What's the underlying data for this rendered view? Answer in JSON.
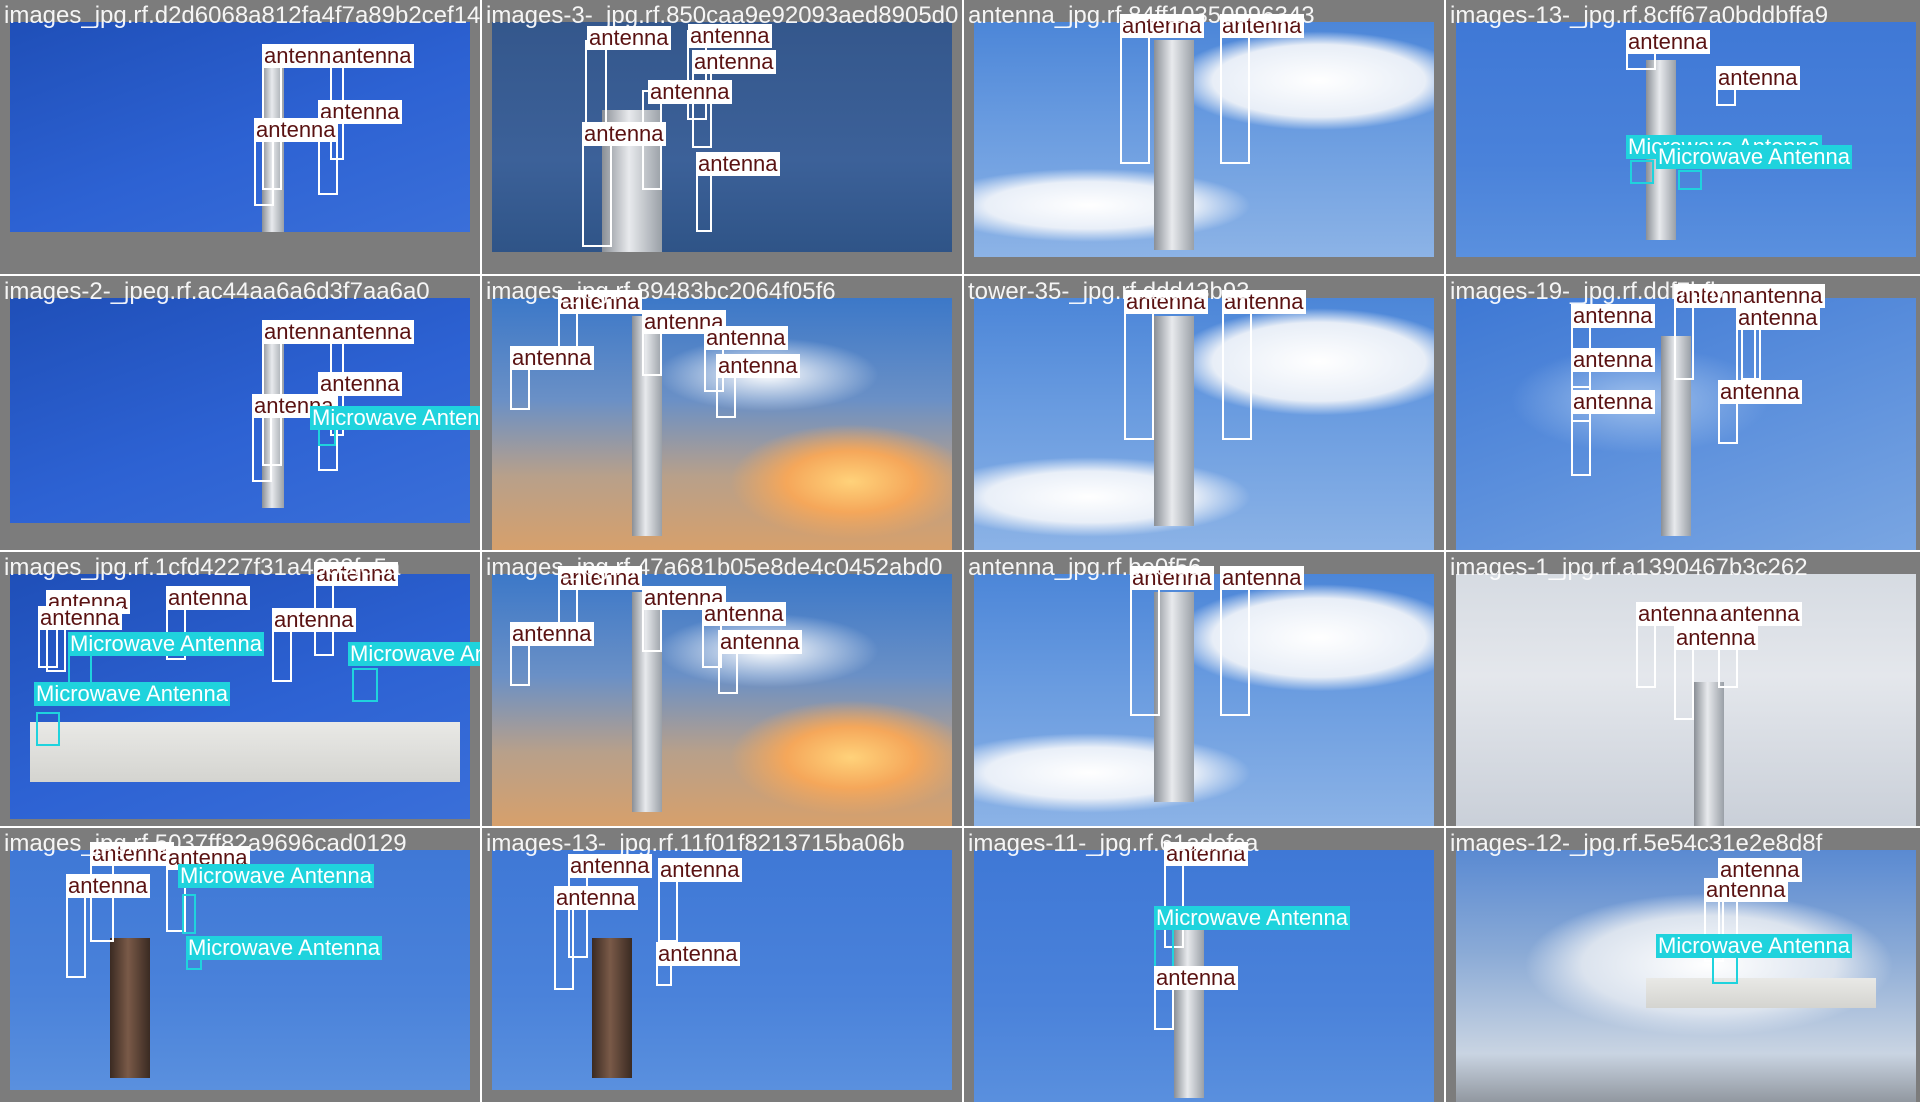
{
  "colors": {
    "antenna_label_bg": "#ffffff",
    "antenna_label_text": "#5a1212",
    "antenna_box": "#ffffff",
    "microwave_label_bg": "#1fd3dd",
    "microwave_label_text": "#ffffff",
    "microwave_box": "#1fd3dd",
    "cell_bg": "#7c7c7c"
  },
  "tiles": [
    {
      "filename": "images_jpg.rf.d2d6068a812fa4f7a89b2cef14",
      "sky": "sky-deep",
      "labels": [
        {
          "cls": "antenna",
          "text": "antenna"
        },
        {
          "cls": "antenna",
          "text": "antenna"
        },
        {
          "cls": "antenna",
          "text": "antenna"
        },
        {
          "cls": "antenna",
          "text": "antenna"
        }
      ]
    },
    {
      "filename": "images-3-_jpg.rf.850caa9e92093aed8905d0",
      "sky": "sky-navy",
      "labels": [
        {
          "cls": "antenna",
          "text": "antenna"
        },
        {
          "cls": "antenna",
          "text": "antenna"
        },
        {
          "cls": "antenna",
          "text": "antenna"
        },
        {
          "cls": "antenna",
          "text": "antenna"
        },
        {
          "cls": "antenna",
          "text": "antenna"
        },
        {
          "cls": "antenna",
          "text": "antenna"
        }
      ]
    },
    {
      "filename": "antenna_jpg.rf.84ff10350996343",
      "sky": "sky-cloud",
      "labels": [
        {
          "cls": "antenna",
          "text": "antenna"
        },
        {
          "cls": "antenna",
          "text": "antenna"
        }
      ]
    },
    {
      "filename": "images-13-_jpg.rf.8cff67a0bddbffa9",
      "sky": "sky-blue",
      "labels": [
        {
          "cls": "antenna",
          "text": "antenna"
        },
        {
          "cls": "antenna",
          "text": "antenna"
        },
        {
          "cls": "microwave",
          "text": "Microwave Antenna"
        },
        {
          "cls": "microwave",
          "text": "Microwave Antenna"
        }
      ]
    },
    {
      "filename": "images-2-_jpeg.rf.ac44aa6a6d3f7aa6a0",
      "sky": "sky-deep",
      "labels": [
        {
          "cls": "antenna",
          "text": "antenna"
        },
        {
          "cls": "antenna",
          "text": "antenna"
        },
        {
          "cls": "antenna",
          "text": "antenna"
        },
        {
          "cls": "antenna",
          "text": "antenna"
        },
        {
          "cls": "microwave",
          "text": "Microwave Antenna"
        }
      ]
    },
    {
      "filename": "images_jpg.rf.89483bc2064f05f6",
      "sky": "sky-sunset",
      "labels": [
        {
          "cls": "antenna",
          "text": "antenna"
        },
        {
          "cls": "antenna",
          "text": "antenna"
        },
        {
          "cls": "antenna",
          "text": "antenna"
        },
        {
          "cls": "antenna",
          "text": "antenna"
        },
        {
          "cls": "antenna",
          "text": "antenna"
        }
      ]
    },
    {
      "filename": "tower-35-_jpg.rf.ddd43b93",
      "sky": "sky-cloud",
      "labels": [
        {
          "cls": "antenna",
          "text": "antenna"
        },
        {
          "cls": "antenna",
          "text": "antenna"
        }
      ]
    },
    {
      "filename": "images-19-_jpg.rf.ddf7bfb",
      "sky": "sky-lightblue",
      "labels": [
        {
          "cls": "antenna",
          "text": "antenna"
        },
        {
          "cls": "antenna",
          "text": "antenna"
        },
        {
          "cls": "antenna",
          "text": "antenna"
        },
        {
          "cls": "antenna",
          "text": "antenna"
        },
        {
          "cls": "antenna",
          "text": "antenna"
        },
        {
          "cls": "antenna",
          "text": "antenna"
        },
        {
          "cls": "antenna",
          "text": "antenna"
        }
      ]
    },
    {
      "filename": "images_jpg.rf.1cfd4227f31a4983fe5a",
      "sky": "sky-deep",
      "labels": [
        {
          "cls": "antenna",
          "text": "antenna"
        },
        {
          "cls": "antenna",
          "text": "antenna"
        },
        {
          "cls": "antenna",
          "text": "antenna"
        },
        {
          "cls": "antenna",
          "text": "antenna"
        },
        {
          "cls": "antenna",
          "text": "antenna"
        },
        {
          "cls": "microwave",
          "text": "Microwave Antenna"
        },
        {
          "cls": "microwave",
          "text": "Microwave Antenna"
        },
        {
          "cls": "microwave",
          "text": "Microwave Antenna"
        }
      ]
    },
    {
      "filename": "images_jpg.rf.47a681b05e8de4c0452abd0",
      "sky": "sky-sunset",
      "labels": [
        {
          "cls": "antenna",
          "text": "antenna"
        },
        {
          "cls": "antenna",
          "text": "antenna"
        },
        {
          "cls": "antenna",
          "text": "antenna"
        },
        {
          "cls": "antenna",
          "text": "antenna"
        },
        {
          "cls": "antenna",
          "text": "antenna"
        }
      ]
    },
    {
      "filename": "antenna_jpg.rf.be0f56",
      "sky": "sky-cloud",
      "labels": [
        {
          "cls": "antenna",
          "text": "antenna"
        },
        {
          "cls": "antenna",
          "text": "antenna"
        }
      ]
    },
    {
      "filename": "images-1_jpg.rf.a1390467b3c262",
      "sky": "sky-pale",
      "labels": [
        {
          "cls": "antenna",
          "text": "antenna"
        },
        {
          "cls": "antenna",
          "text": "antenna"
        },
        {
          "cls": "antenna",
          "text": "antenna"
        }
      ]
    },
    {
      "filename": "images_jpg.rf.5037ff82a9696cad0129",
      "sky": "sky-blue",
      "labels": [
        {
          "cls": "antenna",
          "text": "antenna"
        },
        {
          "cls": "antenna",
          "text": "antenna"
        },
        {
          "cls": "antenna",
          "text": "antenna"
        },
        {
          "cls": "microwave",
          "text": "Microwave Antenna"
        },
        {
          "cls": "microwave",
          "text": "Microwave Antenna"
        }
      ]
    },
    {
      "filename": "images-13-_jpg.rf.11f01f8213715ba06b",
      "sky": "sky-blue",
      "labels": [
        {
          "cls": "antenna",
          "text": "antenna"
        },
        {
          "cls": "antenna",
          "text": "antenna"
        },
        {
          "cls": "antenna",
          "text": "antenna"
        },
        {
          "cls": "antenna",
          "text": "antenna"
        }
      ]
    },
    {
      "filename": "images-11-_jpg.rf.61adefca",
      "sky": "sky-blue",
      "labels": [
        {
          "cls": "antenna",
          "text": "antenna"
        },
        {
          "cls": "microwave",
          "text": "Microwave Antenna"
        },
        {
          "cls": "antenna",
          "text": "antenna"
        }
      ]
    },
    {
      "filename": "images-12-_jpg.rf.5e54c31e2e8d8f",
      "sky": "sky-overcast",
      "labels": [
        {
          "cls": "antenna",
          "text": "antenna"
        },
        {
          "cls": "antenna",
          "text": "antenna"
        },
        {
          "cls": "microwave",
          "text": "Microwave Antenna"
        }
      ]
    }
  ]
}
